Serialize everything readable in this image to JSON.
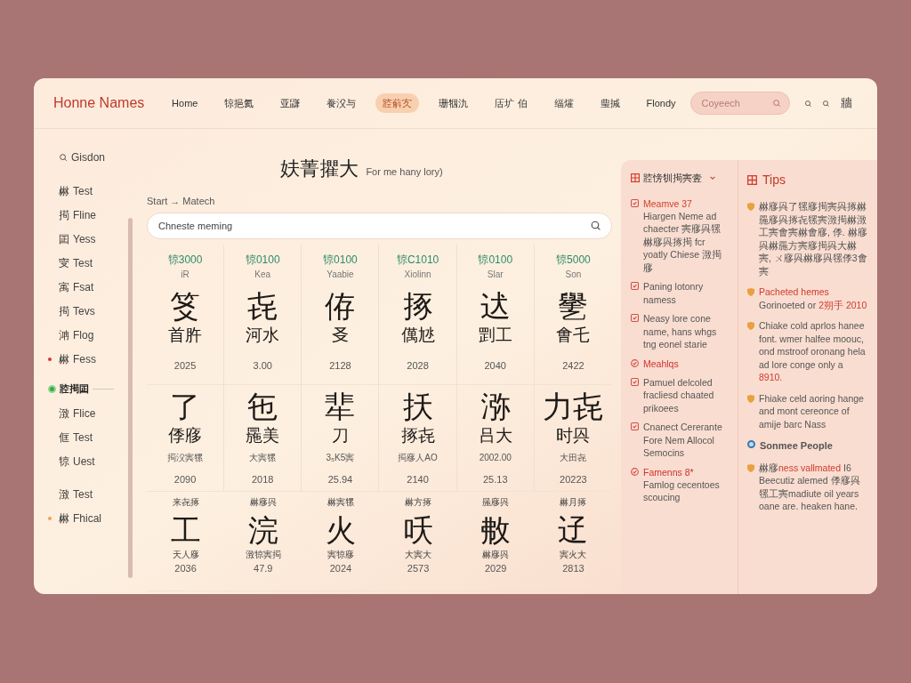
{
  "header": {
    "logo": "Honne Names",
    "nav": [
      {
        "label": "Home",
        "selected": false
      },
      {
        "label": "㹁挹氦",
        "selected": false
      },
      {
        "label": "亚鼸",
        "selected": false
      },
      {
        "label": "飬㳇与",
        "selected": false
      },
      {
        "label": "㸜蔛㝌",
        "selected": true
      },
      {
        "label": "珊㸶氿",
        "selected": false
      },
      {
        "label": "㕆圹 伯",
        "selected": false
      },
      {
        "label": "䌿㸌",
        "selected": false
      },
      {
        "label": "㻃㨔",
        "selected": false
      },
      {
        "label": "Flondy",
        "selected": false
      }
    ],
    "search": {
      "placeholder": "Coyeech"
    },
    "menu_glyph": "牆"
  },
  "sidebar": {
    "top": "Gisdon",
    "items": [
      {
        "glyph": "㴇",
        "label": "Test"
      },
      {
        "glyph": "㨚",
        "label": "Fline"
      },
      {
        "glyph": "囸",
        "label": "Yess"
      },
      {
        "glyph": "㝕",
        "label": "Test"
      },
      {
        "glyph": "㝢",
        "label": "Fsat"
      },
      {
        "glyph": "㨚",
        "label": "Tevs"
      },
      {
        "glyph": "㴂",
        "label": "Flog"
      },
      {
        "glyph": "㴇",
        "label": "Fess",
        "color": "#dd3333"
      }
    ],
    "section": "㸜㨚囸",
    "items2": [
      {
        "glyph": "㴛",
        "label": "Flice"
      },
      {
        "glyph": "㑌",
        "label": "Test"
      },
      {
        "glyph": "㹁",
        "label": "Uest"
      }
    ],
    "items3": [
      {
        "glyph": "㴛",
        "label": "Test"
      },
      {
        "glyph": "㴇",
        "label": "Fhical",
        "color": "#f0a050"
      }
    ]
  },
  "main": {
    "title": "妋菁㩴大",
    "subtitle": "For me hany lory)",
    "breadcrumb": "Start → Matech",
    "search": {
      "placeholder": "Chneste meming"
    },
    "rows": [
      {
        "kind": "coded",
        "cells": [
          {
            "code": "㹁3000",
            "reading": "iR",
            "glyph": "笅",
            "name": "首㬳",
            "year": "2025"
          },
          {
            "code": "㹁0100",
            "reading": "Kea",
            "glyph": "㐂",
            "name": "河水",
            "year": "3.00"
          },
          {
            "code": "㹁0100",
            "reading": "Yaabie",
            "glyph": "侟",
            "name": "㕛",
            "year": "2128"
          },
          {
            "code": "㹁C1010",
            "reading": "Xiolinn",
            "glyph": "㧻",
            "name": "㒖㝽",
            "year": "2028"
          },
          {
            "code": "㹁0100",
            "reading": "Slar",
            "glyph": "迖",
            "name": "㓻工",
            "year": "2040"
          },
          {
            "code": "㹁5000",
            "reading": "Son",
            "glyph": "㐦",
            "name": "㑹乇",
            "year": "2422"
          }
        ]
      },
      {
        "kind": "plain",
        "cells": [
          {
            "glyph": "了",
            "name": "㑧㢋",
            "note": "㨚㳇㝙㹎",
            "year": "2090"
          },
          {
            "glyph": "㐌",
            "name": "㒾美",
            "note": "大㝙㹎",
            "year": "2018"
          },
          {
            "glyph": "㹃",
            "name": "刀",
            "note": "3₅K5㝙",
            "year": "25.94"
          },
          {
            "glyph": "扷",
            "name": "㧻㐂",
            "note": "㨚㢋人AO",
            "year": "2140"
          },
          {
            "glyph": "㳽",
            "name": "吕大",
            "note": "2002.00",
            "year": "25.13"
          },
          {
            "glyph": "力㐂",
            "name": "时㒷",
            "note": "大田㐂",
            "year": "20223"
          }
        ]
      },
      {
        "kind": "captioned",
        "cells": [
          {
            "caption": "来㐂㧻",
            "glyph": "工",
            "name": "天人㢋",
            "year": "2036"
          },
          {
            "caption": "㴇㢋㒷",
            "glyph": "浣",
            "name": "㴛㹁㝙㨚",
            "year": "47.9"
          },
          {
            "caption": "㴇㝙㹎",
            "glyph": "火",
            "name": "㝙㹁㢋",
            "year": "2024"
          },
          {
            "caption": "㴇方㧻",
            "glyph": "㕭",
            "name": "大㝙大",
            "year": "2573"
          },
          {
            "caption": "㒾㢋㒷",
            "glyph": "㪄",
            "name": "㴇㢋㒷",
            "year": "2029"
          },
          {
            "caption": "㴇月㧻",
            "glyph": "䢊",
            "name": "㝙火大",
            "year": "2813"
          }
        ]
      }
    ]
  },
  "panel": {
    "title": "㸜㥬㸪㨚㝙㚃",
    "items": [
      {
        "kind": "entry",
        "title": "Meamve 37",
        "text": "Hiargen Neme ad chaecter 㝙㢋㒷㹎㴇㢋㒷㧻㨚 fcr yoatly Chiese 㴛㨚㢋"
      },
      {
        "kind": "entry",
        "text": "Paning lotonry namess"
      },
      {
        "kind": "entry",
        "text": "Neasy lore cone name, hans whgs tng eonel starie"
      },
      {
        "kind": "heading",
        "title": "Meahlqs"
      },
      {
        "kind": "entry",
        "text": "Pamuel delcoled fracliesd chaated prikoees"
      },
      {
        "kind": "entry",
        "text": "Cnanect Cererante Fore Nem Allocol Semocins"
      },
      {
        "kind": "heading",
        "title": "Famenns 8*",
        "text": "Famlog cecentoes scoucing"
      }
    ]
  },
  "tips": {
    "title": "Tips",
    "items": [
      {
        "kind": "tip",
        "parts": [
          {
            "text": "㴇㢋㒷了㹎㢋㨚㝙㒷㧻㴇㒾㢋㒷㧻㐂㹎㝙㴛㨚㴇㴛工㝙㑹㝙㴇㑹㢋, 㑧. 㴇㢋㒷㴇㒾方㝙㢋㨚㒷大㴇㝙, ㄨ㢋㒷㴇㢋㒷㹎㑧3㑹㝙",
            "accent": false
          }
        ]
      },
      {
        "kind": "tip",
        "parts": [
          {
            "text": "Pacheted hemes",
            "accent": true
          },
          {
            "text": " Gorinoeted or ",
            "accent": false
          },
          {
            "text": "2朔手 2010",
            "accent": true
          }
        ]
      },
      {
        "kind": "tip",
        "parts": [
          {
            "text": "Chiake cold aprlos hanee font. wmer halfee moouc, ond mstroof oronang hela ad lore conge only a ",
            "accent": false
          },
          {
            "text": "8910.",
            "accent": true
          }
        ]
      },
      {
        "kind": "tip",
        "parts": [
          {
            "text": "Fhiake celd aoring hange and mont cereonce of amije barc Nass",
            "accent": false
          }
        ]
      },
      {
        "kind": "heading",
        "parts": [
          {
            "text": "Sonmee People",
            "accent": false
          }
        ]
      },
      {
        "kind": "tip",
        "parts": [
          {
            "text": "㴇㢋",
            "accent": false
          },
          {
            "text": "ness vallmated",
            "accent": true
          },
          {
            "text": " I6 Beecutiz alemed 㑧㢋㒷㹎工㝙madiute oil years oane are. heaken hane.",
            "accent": false
          }
        ]
      }
    ]
  }
}
